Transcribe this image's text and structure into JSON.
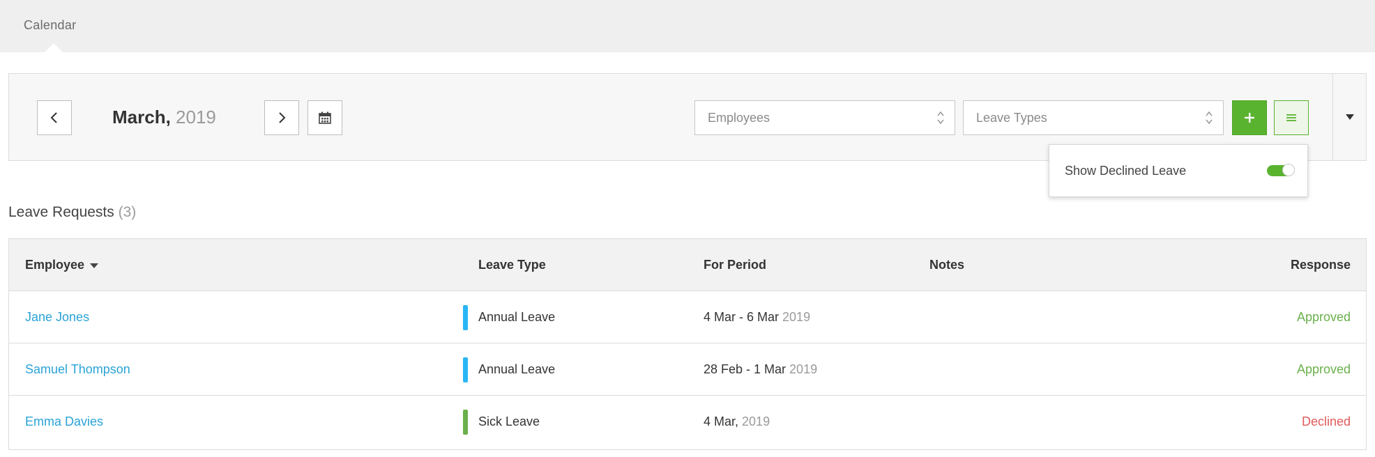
{
  "nav": {
    "tab_label": "Calendar"
  },
  "toolbar": {
    "month": "March,",
    "year": "2019",
    "employees_placeholder": "Employees",
    "leave_types_placeholder": "Leave Types",
    "icons": {
      "prev": "chevron-left-icon",
      "next": "chevron-right-icon",
      "calendar": "calendar-icon",
      "add": "plus-icon",
      "menu": "menu-icon",
      "collapse": "caret-down-icon"
    }
  },
  "popover": {
    "label": "Show Declined Leave",
    "toggle_on": true
  },
  "leave_requests": {
    "title": "Leave Requests",
    "count": "(3)",
    "columns": {
      "employee": "Employee",
      "leave_type": "Leave Type",
      "for_period": "For Period",
      "notes": "Notes",
      "response": "Response"
    },
    "rows": [
      {
        "employee": "Jane Jones",
        "leave_type": "Annual Leave",
        "type_color": "#29b6f6",
        "period": "4 Mar - 6 Mar",
        "period_year": " 2019",
        "notes": "",
        "response": "Approved",
        "response_color": "#6ab04c"
      },
      {
        "employee": "Samuel Thompson",
        "leave_type": "Annual Leave",
        "type_color": "#29b6f6",
        "period": "28 Feb - 1 Mar",
        "period_year": " 2019",
        "notes": "",
        "response": "Approved",
        "response_color": "#6ab04c"
      },
      {
        "employee": "Emma Davies",
        "leave_type": "Sick Leave",
        "type_color": "#6ab04c",
        "period": "4 Mar,",
        "period_year": " 2019",
        "notes": "",
        "response": "Declined",
        "response_color": "#e05a5a"
      }
    ]
  },
  "colors": {
    "accent_green": "#5ab32f",
    "link_blue": "#2aa3d6"
  }
}
